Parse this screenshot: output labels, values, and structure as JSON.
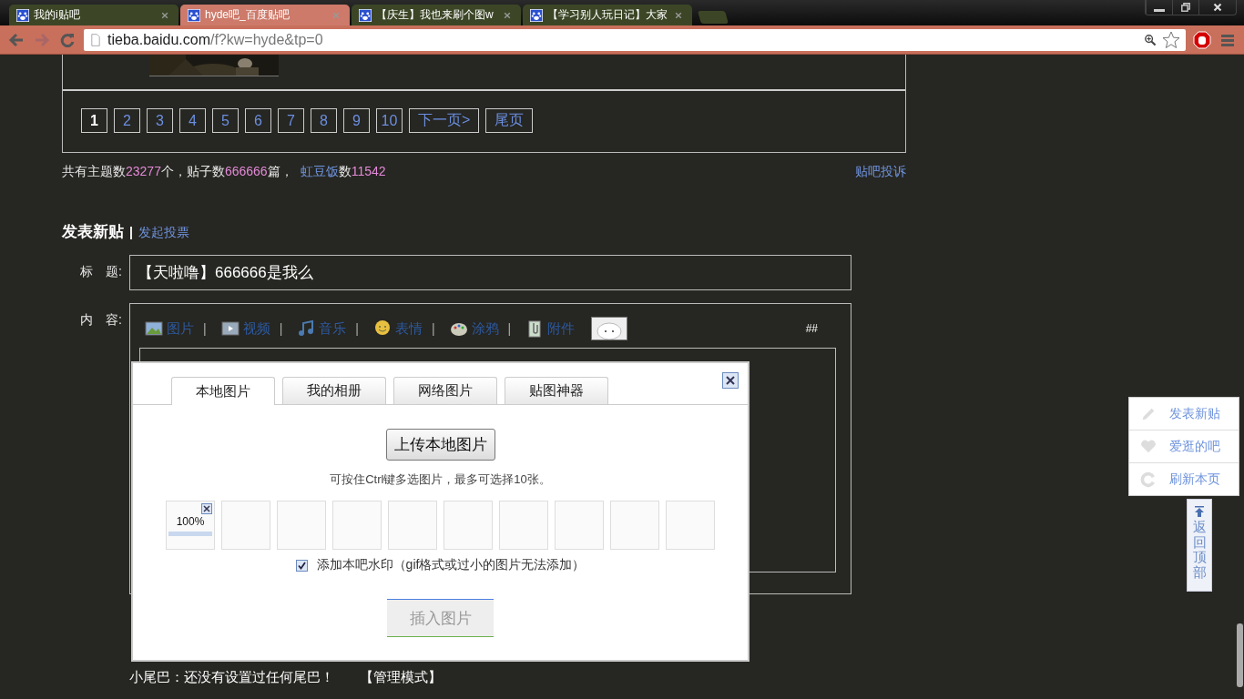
{
  "browser": {
    "tabs": [
      {
        "title": "我的i贴吧",
        "selected": false
      },
      {
        "title": "hyde吧_百度贴吧",
        "selected": true
      },
      {
        "title": "【庆生】我也来刷个图w",
        "selected": false
      },
      {
        "title": "【学习别人玩日记】大家",
        "selected": false
      }
    ],
    "url": {
      "host": "tieba.baidu.com",
      "path": "/f?kw=hyde&tp=0"
    }
  },
  "pager": {
    "pages": [
      {
        "label": "1",
        "selected": true
      },
      {
        "label": "2",
        "selected": false
      },
      {
        "label": "3",
        "selected": false
      },
      {
        "label": "4",
        "selected": false
      },
      {
        "label": "5",
        "selected": false
      },
      {
        "label": "6",
        "selected": false
      },
      {
        "label": "7",
        "selected": false
      },
      {
        "label": "8",
        "selected": false
      },
      {
        "label": "9",
        "selected": false
      },
      {
        "label": "10",
        "selected": false
      }
    ],
    "next": "下一页>",
    "last": "尾页"
  },
  "stats": [
    {
      "kind": "plain",
      "text": "共有主题数"
    },
    {
      "kind": "number",
      "text": "23277"
    },
    {
      "kind": "plain",
      "text": "个，贴子数"
    },
    {
      "kind": "number",
      "text": "666666"
    },
    {
      "kind": "plain",
      "text": "篇，"
    },
    {
      "kind": "link",
      "text": "虹豆饭"
    },
    {
      "kind": "plain",
      "text": "数"
    },
    {
      "kind": "number",
      "text": "11542"
    }
  ],
  "complaint_link": "贴吧投诉",
  "post": {
    "heading": "发表新贴",
    "separator": "|",
    "vote_link": "发起投票",
    "title_label": "标　题:",
    "title_value": "【天啦噜】666666是我么",
    "content_label": "内　容:",
    "toolbar": [
      {
        "kind": "picture",
        "label": "图片",
        "separator": "|"
      },
      {
        "kind": "video",
        "label": "视频",
        "separator": "|"
      },
      {
        "kind": "music",
        "label": "音乐",
        "separator": "|"
      },
      {
        "kind": "emoji",
        "label": "表情",
        "separator": "|"
      },
      {
        "kind": "paint",
        "label": "涂鸦",
        "separator": "|"
      },
      {
        "kind": "attach",
        "label": "附件"
      }
    ],
    "hash": "##"
  },
  "dialog": {
    "tabs": [
      {
        "label": "本地图片",
        "selected": true
      },
      {
        "label": "我的相册",
        "selected": false
      },
      {
        "label": "网络图片",
        "selected": false
      },
      {
        "label": "贴图神器",
        "selected": false
      }
    ],
    "upload_button": "上传本地图片",
    "hint": "可按住Ctrl键多选图片，最多可选择10张。",
    "slots": [
      {
        "kind": "uploaded",
        "reading": "100%",
        "level": 1
      },
      {
        "kind": "empty"
      },
      {
        "kind": "empty"
      },
      {
        "kind": "empty"
      },
      {
        "kind": "empty"
      },
      {
        "kind": "empty"
      },
      {
        "kind": "empty"
      },
      {
        "kind": "empty"
      },
      {
        "kind": "empty"
      },
      {
        "kind": "empty"
      }
    ],
    "watermark": {
      "checked": true,
      "label": "添加本吧水印（gif格式或过小的图片无法添加）"
    },
    "insert_button": {
      "label": "插入图片",
      "disabled": true
    }
  },
  "tail": {
    "text": "小尾巴：还没有设置过任何尾巴！",
    "manage_link": "【管理模式】"
  },
  "side_menu": [
    {
      "kind": "pencil",
      "label": "发表新贴"
    },
    {
      "kind": "heart",
      "label": "爱逛的吧"
    },
    {
      "kind": "refresh",
      "label": "刷新本页"
    }
  ],
  "back_to_top": "返回顶部"
}
